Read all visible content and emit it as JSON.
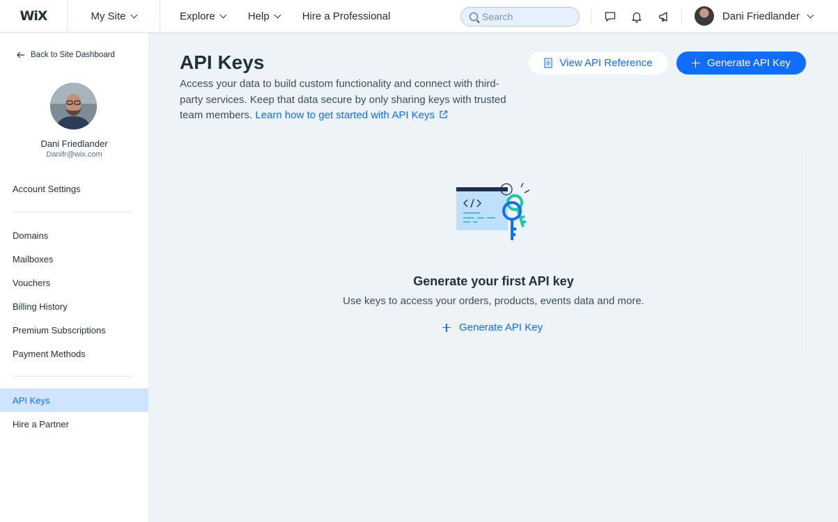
{
  "topbar": {
    "logo": "WiX",
    "site_menu": "My Site",
    "nav": [
      "Explore",
      "Help",
      "Hire a Professional"
    ],
    "search_placeholder": "Search",
    "user_name": "Dani Friedlander"
  },
  "sidebar": {
    "back_label": "Back to Site Dashboard",
    "profile_name": "Dani Friedlander",
    "profile_email": "Danifr@wix.com",
    "account_settings": "Account Settings",
    "items": [
      "Domains",
      "Mailboxes",
      "Vouchers",
      "Billing History",
      "Premium Subscriptions",
      "Payment Methods"
    ],
    "api_keys": "API Keys",
    "hire_partner": "Hire a Partner"
  },
  "main": {
    "title": "API Keys",
    "description": "Access your data to build custom functionality and connect with third-party services. Keep that data secure by only sharing keys with trusted team members.",
    "learn_link": "Learn how to get started with API Keys",
    "view_reference": "View API Reference",
    "generate_button": "Generate API Key",
    "empty_title": "Generate your first API key",
    "empty_subtitle": "Use keys to access your orders, products, events data and more.",
    "empty_cta": "Generate API Key"
  },
  "colors": {
    "accent": "#116dff",
    "active_bg": "#cfe5ff",
    "page_bg": "#eef3f7",
    "text": "#20303c"
  },
  "icons": [
    "chevron-down-icon",
    "search-icon",
    "chat-icon",
    "bell-icon",
    "megaphone-icon",
    "arrow-left-icon",
    "document-icon",
    "plus-icon",
    "external-link-icon",
    "api-keys-illustration"
  ]
}
